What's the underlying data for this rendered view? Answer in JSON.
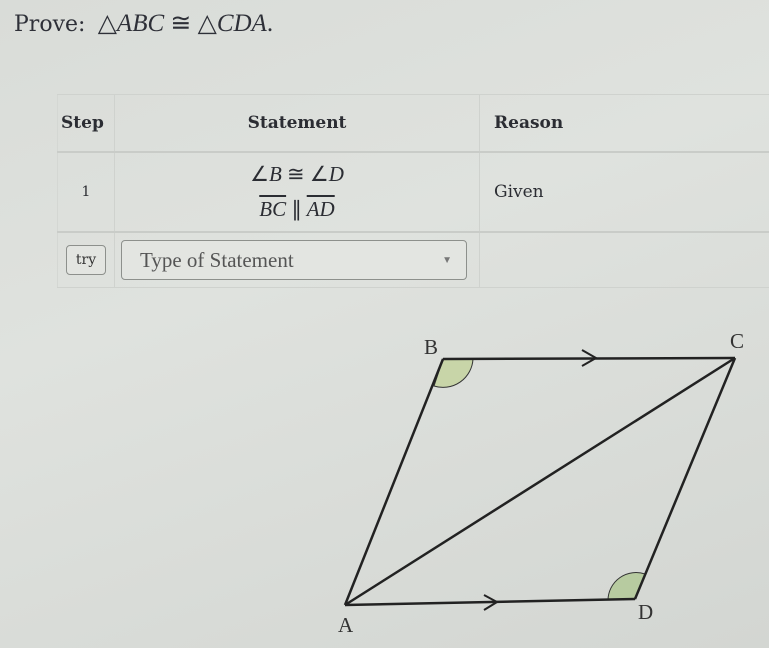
{
  "prove": {
    "label": "Prove:",
    "tri1_symbol": "△",
    "tri1": "ABC",
    "congruent": "≅",
    "tri2_symbol": "△",
    "tri2": "CDA",
    "end": "."
  },
  "table": {
    "headers": {
      "step": "Step",
      "statement": "Statement",
      "reason": "Reason"
    },
    "rows": [
      {
        "step": "1",
        "statement_line1": {
          "angle": "∠",
          "a": "B",
          "rel": "≅",
          "angle2": "∠",
          "b": "D"
        },
        "statement_line2": {
          "seg1": "BC",
          "rel": "∥",
          "seg2": "AD"
        },
        "reason": "Given"
      }
    ],
    "input_row": {
      "try_label": "try",
      "select_placeholder": "Type of Statement",
      "reason": ""
    }
  },
  "diagram": {
    "vertices": {
      "A": "A",
      "B": "B",
      "C": "C",
      "D": "D"
    },
    "angle_fill": "#c8d5a8",
    "angle_fill_d": "#b7cba0"
  }
}
